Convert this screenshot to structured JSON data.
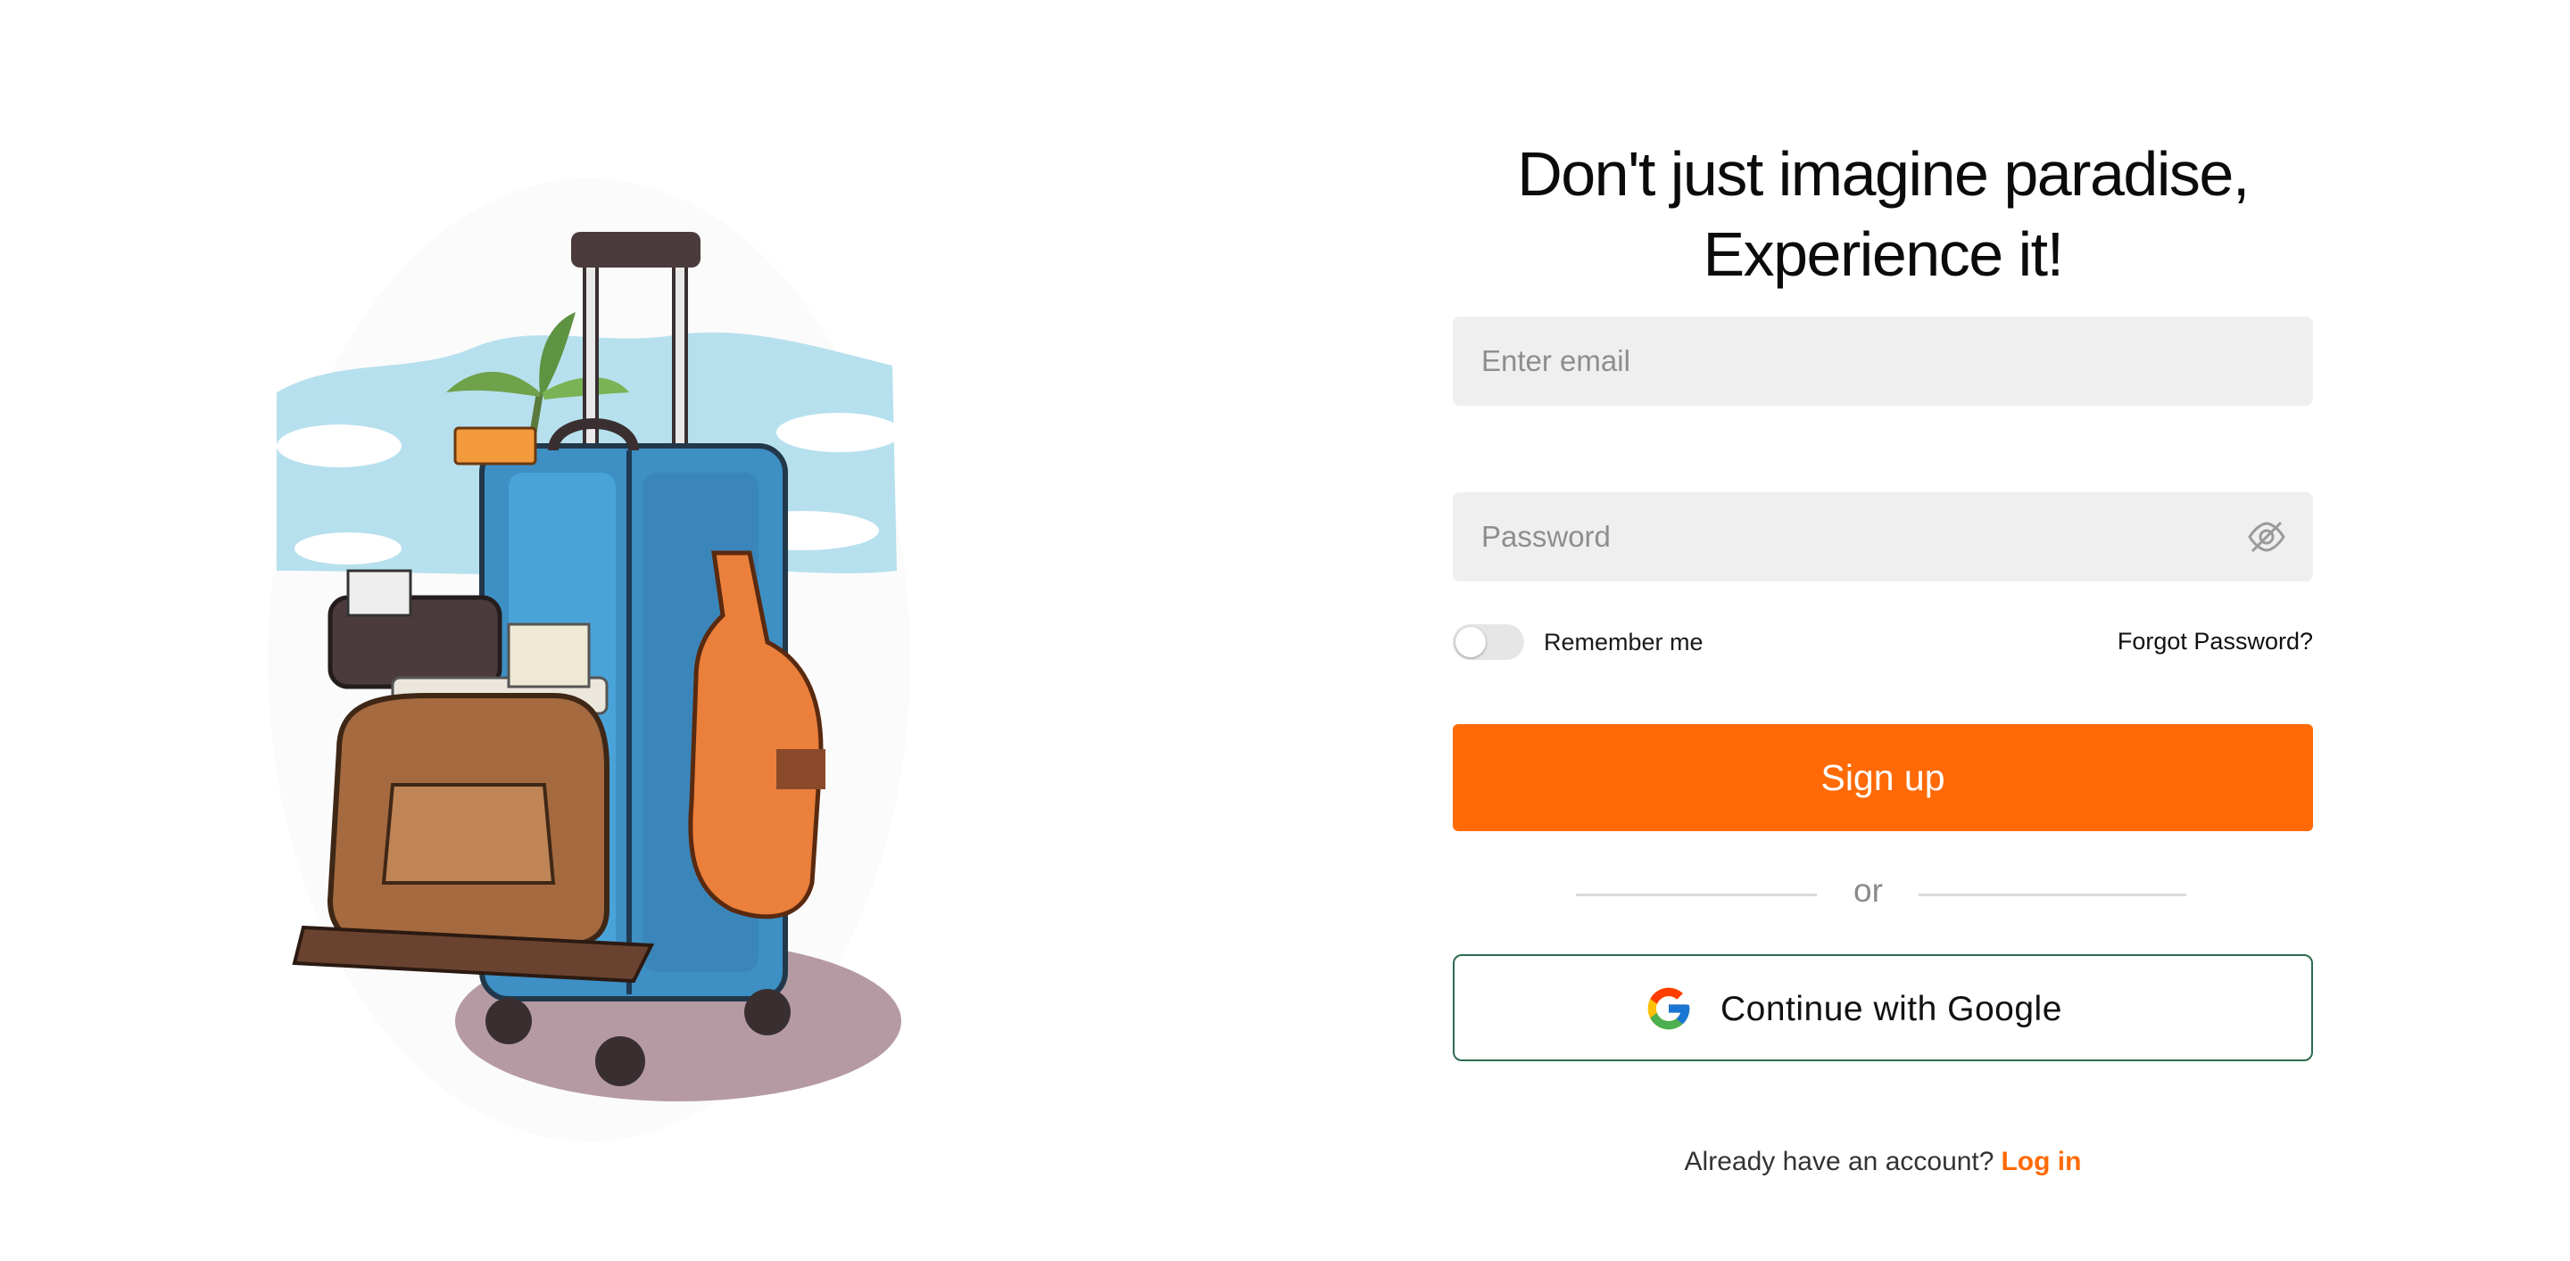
{
  "colors": {
    "accent": "#ff6a06",
    "input_bg": "#efefef",
    "google_border": "#2e6b4f"
  },
  "illustration": {
    "icon": "travel-suitcase-illustration"
  },
  "headline": {
    "line1": "Don't just imagine paradise,",
    "line2": "Experience it!"
  },
  "form": {
    "email_placeholder": "Enter email",
    "password_placeholder": "Password",
    "password_toggle_icon": "eye-off-icon",
    "remember_label": "Remember me",
    "remember_checked": false,
    "forgot_label": "Forgot Password?",
    "signup_label": "Sign up",
    "divider_label": "or",
    "google_label": "Continue with Google",
    "google_icon": "google-logo-icon"
  },
  "footer": {
    "prompt": "Already have an account?",
    "login_label": "Log in"
  }
}
